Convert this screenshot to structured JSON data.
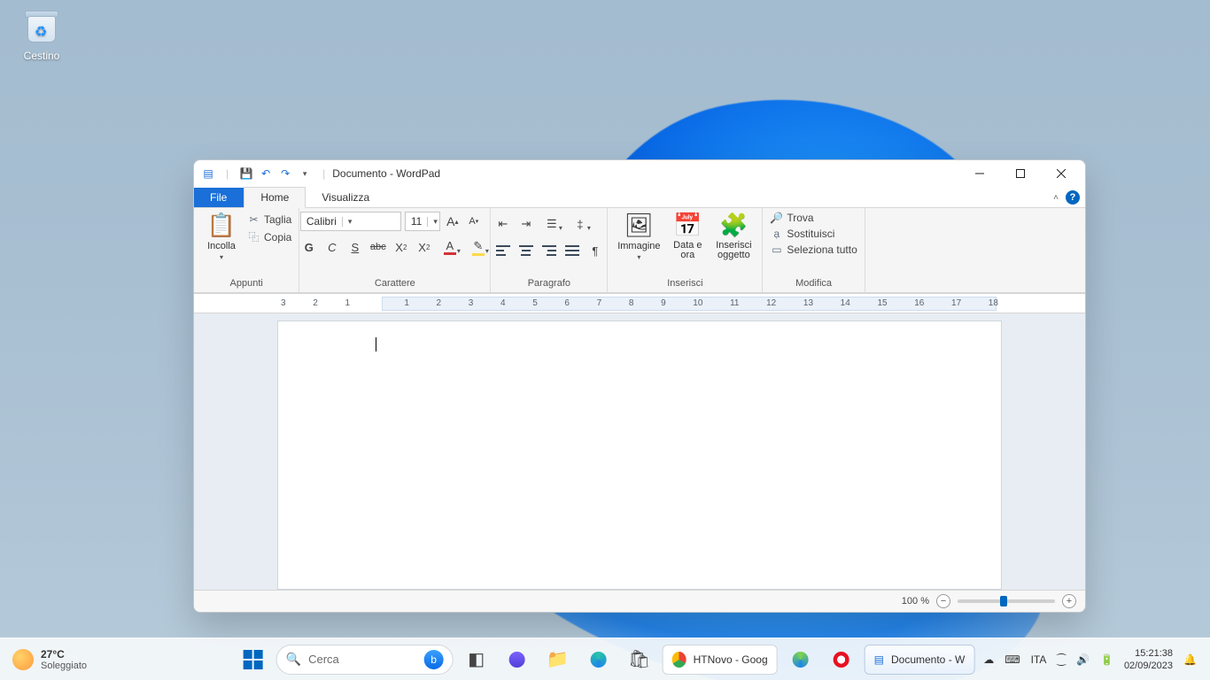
{
  "desktop": {
    "recycle_bin": "Cestino"
  },
  "window": {
    "title": "Documento - WordPad",
    "tabs": {
      "file": "File",
      "home": "Home",
      "view": "Visualizza"
    }
  },
  "ribbon": {
    "clipboard": {
      "group": "Appunti",
      "paste": "Incolla",
      "cut": "Taglia",
      "copy": "Copia"
    },
    "font": {
      "group": "Carattere",
      "family": "Calibri",
      "size": "11"
    },
    "paragraph": {
      "group": "Paragrafo"
    },
    "insert": {
      "group": "Inserisci",
      "picture": "Immagine",
      "datetime": "Data e ora",
      "object": "Inserisci oggetto"
    },
    "editing": {
      "group": "Modifica",
      "find": "Trova",
      "replace": "Sostituisci",
      "select_all": "Seleziona tutto"
    }
  },
  "ruler": {
    "labels": [
      "3",
      "2",
      "1",
      "",
      "1",
      "2",
      "3",
      "4",
      "5",
      "6",
      "7",
      "8",
      "9",
      "10",
      "11",
      "12",
      "13",
      "14",
      "15",
      "16",
      "17",
      "18"
    ]
  },
  "status": {
    "zoom": "100 %"
  },
  "taskbar": {
    "weather_temp": "27°C",
    "weather_desc": "Soleggiato",
    "search_placeholder": "Cerca",
    "apps": {
      "chrome_tab": "HTNovo - Goog",
      "wordpad_tab": "Documento - W"
    },
    "tray": {
      "lang": "ITA",
      "time": "15:21:38",
      "date": "02/09/2023"
    }
  }
}
